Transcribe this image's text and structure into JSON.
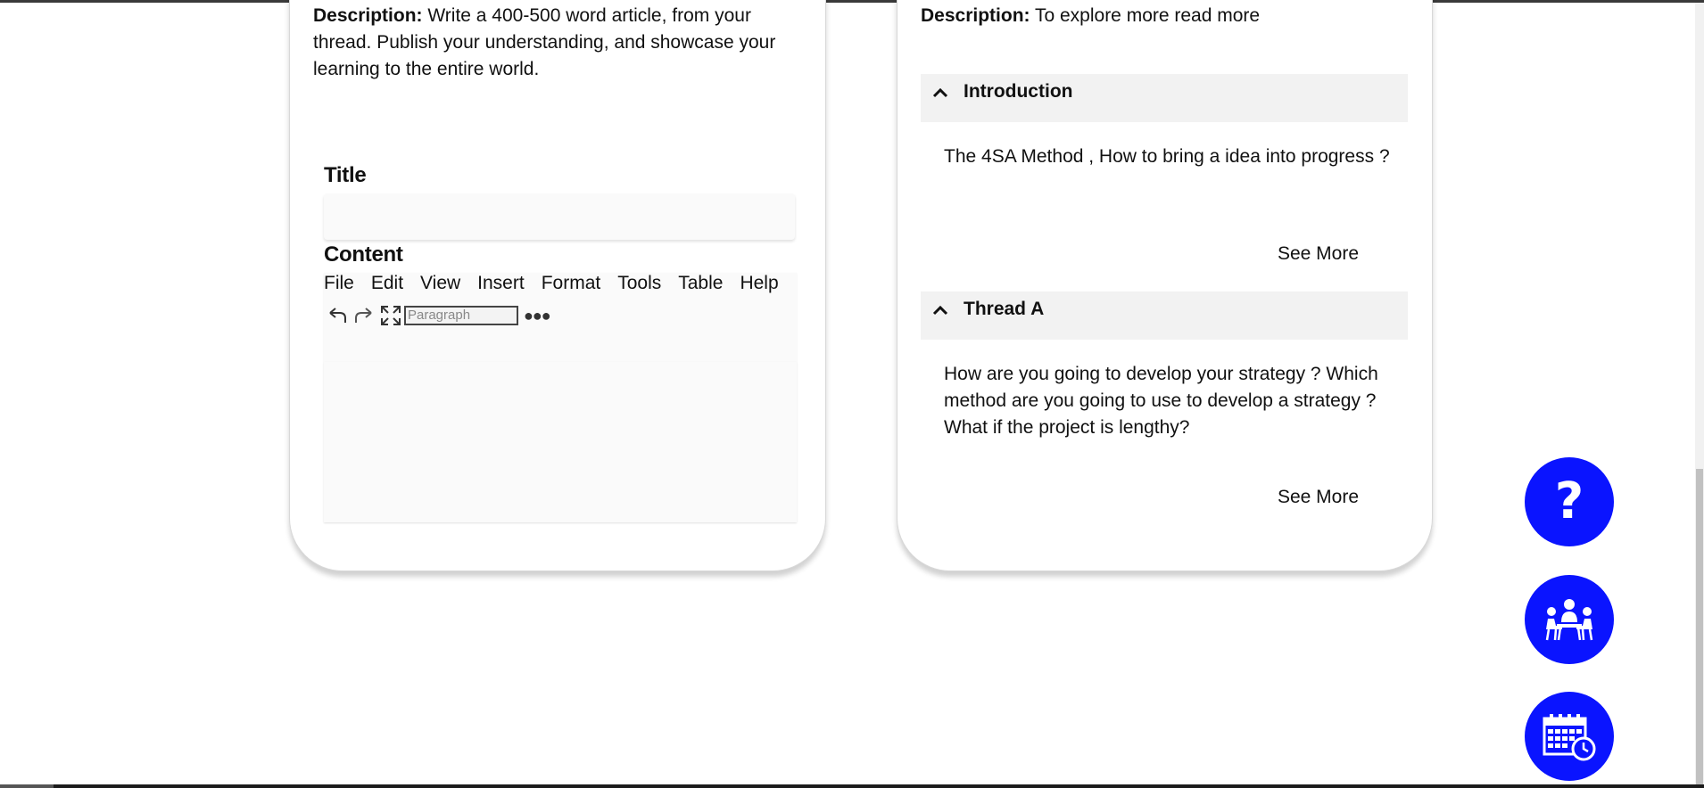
{
  "left_card": {
    "description_label": "Description:",
    "description_text": " Write a 400-500 word article, from your thread. Publish your understanding, and showcase your learning to the entire world.",
    "title_label": "Title",
    "title_value": "",
    "content_label": "Content",
    "editor": {
      "menu": [
        "File",
        "Edit",
        "View",
        "Insert",
        "Format",
        "Tools",
        "Table",
        "Help"
      ],
      "block_format": "Paragraph",
      "icons": [
        "undo-icon",
        "redo-icon",
        "fullscreen-icon",
        "more-icon"
      ],
      "content": ""
    }
  },
  "right_card": {
    "description_label": "Description:",
    "description_text": " To explore more read more",
    "sections": [
      {
        "title": "Introduction",
        "body": "The 4SA Method , How to bring a idea into progress ?",
        "see_more": "See More"
      },
      {
        "title": "Thread A",
        "body": "How are you going to develop your strategy ? Which method are you going to use to develop a strategy ? What if the project is lengthy?",
        "see_more": "See More"
      }
    ]
  },
  "fabs": [
    {
      "icon": "help-icon",
      "symbol": "?"
    },
    {
      "icon": "meeting-icon"
    },
    {
      "icon": "calendar-clock-icon"
    }
  ],
  "colors": {
    "fab_blue": "#0a14ff",
    "accordion_header": "#f2f2f2"
  }
}
